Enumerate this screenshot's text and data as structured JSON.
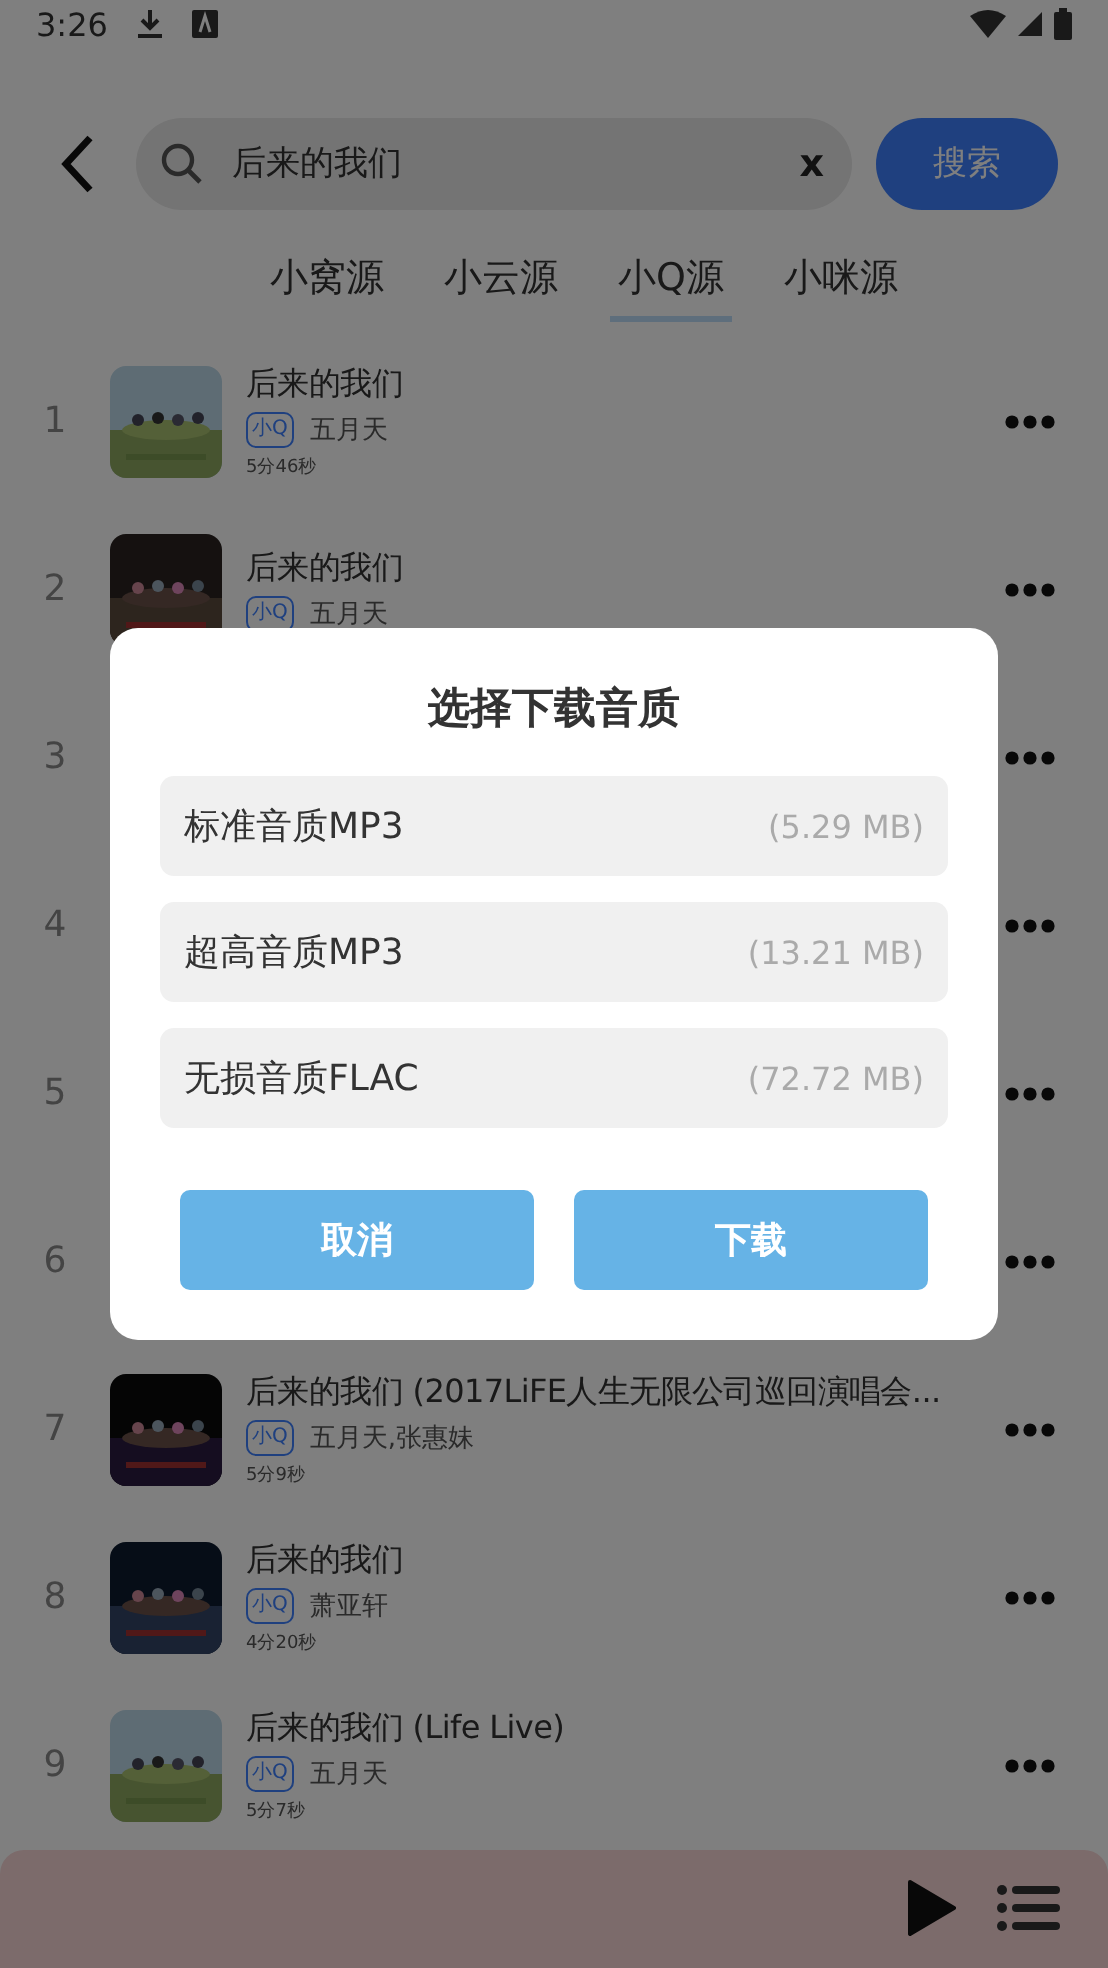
{
  "status_bar": {
    "time": "3:26"
  },
  "search": {
    "value": "后来的我们",
    "clear": "x",
    "button": "搜索"
  },
  "tabs": [
    {
      "label": "小窝源",
      "selected": false
    },
    {
      "label": "小云源",
      "selected": false
    },
    {
      "label": "小Q源",
      "selected": true
    },
    {
      "label": "小咪源",
      "selected": false
    }
  ],
  "songs": [
    {
      "index": "1",
      "title": "后来的我们",
      "badge": "小Q",
      "artist": "五月天",
      "duration": "5分46秒"
    },
    {
      "index": "2",
      "title": "后来的我们",
      "badge": "小Q",
      "artist": "五月天"
    },
    {
      "index": "3"
    },
    {
      "index": "4"
    },
    {
      "index": "5"
    },
    {
      "index": "6"
    },
    {
      "index": "7",
      "title": "后来的我们 (2017LiFE人生无限公司巡回演唱会...",
      "badge": "小Q",
      "artist": "五月天,张惠妹",
      "duration": "5分9秒"
    },
    {
      "index": "8",
      "title": "后来的我们",
      "badge": "小Q",
      "artist": "萧亚轩",
      "duration": "4分20秒"
    },
    {
      "index": "9",
      "title": "后来的我们 (Life Live)",
      "badge": "小Q",
      "artist": "五月天",
      "duration": "5分7秒"
    }
  ],
  "dialog": {
    "title": "选择下载音质",
    "options": [
      {
        "label": "标准音质MP3",
        "size": "(5.29 MB)"
      },
      {
        "label": "超高音质MP3",
        "size": "(13.21 MB)"
      },
      {
        "label": "无损音质FLAC",
        "size": "(72.72 MB)"
      }
    ],
    "buttons": [
      {
        "label": "取消"
      },
      {
        "label": "下载"
      }
    ]
  }
}
